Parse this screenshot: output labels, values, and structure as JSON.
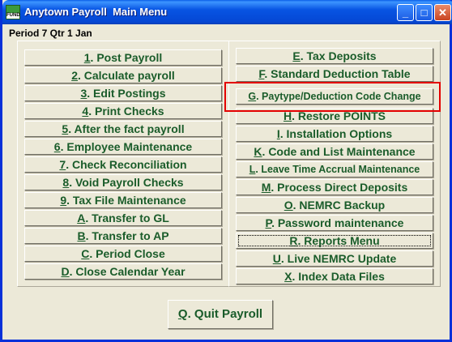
{
  "window": {
    "title": "Anytown Payroll  Main Menu",
    "icon_label": "FUND",
    "minimize": "_",
    "maximize": "□",
    "close": "✕"
  },
  "period": "Period 7 Qtr 1 Jan",
  "left_menu": [
    {
      "key": "1",
      "label": ". Post Payroll"
    },
    {
      "key": "2",
      "label": ". Calculate payroll"
    },
    {
      "key": "3",
      "label": ". Edit Postings"
    },
    {
      "key": "4",
      "label": ". Print Checks"
    },
    {
      "key": "5",
      "label": ". After the fact payroll"
    },
    {
      "key": "6",
      "label": ". Employee Maintenance"
    },
    {
      "key": "7",
      "label": ". Check Reconciliation"
    },
    {
      "key": "8",
      "label": ". Void Payroll Checks"
    },
    {
      "key": "9",
      "label": ". Tax File Maintenance"
    },
    {
      "key": "A",
      "label": ". Transfer to GL"
    },
    {
      "key": "B",
      "label": ". Transfer to AP"
    },
    {
      "key": "C",
      "label": ". Period Close"
    },
    {
      "key": "D",
      "label": ". Close Calendar Year"
    }
  ],
  "right_menu": [
    {
      "key": "E",
      "label": ". Tax Deposits"
    },
    {
      "key": "F",
      "label": ". Standard Deduction Table"
    },
    {
      "key": "G",
      "label": ". Paytype/Deduction Code Change"
    },
    {
      "key": "H",
      "label": ". Restore POINTS"
    },
    {
      "key": "I",
      "label": ". Installation Options"
    },
    {
      "key": "K",
      "label": ". Code and List Maintenance"
    },
    {
      "key": "L",
      "label": ". Leave Time Accrual Maintenance"
    },
    {
      "key": "M",
      "label": ". Process Direct Deposits"
    },
    {
      "key": "O",
      "label": ". NEMRC Backup"
    },
    {
      "key": "P",
      "label": ". Password maintenance"
    },
    {
      "key": "R",
      "label": ". Reports Menu"
    },
    {
      "key": "U",
      "label": ". Live NEMRC Update"
    },
    {
      "key": "X",
      "label": ". Index Data Files"
    }
  ],
  "quit": {
    "key": "Q",
    "label": ". Quit Payroll"
  },
  "colors": {
    "button_text": "#1a5c2a",
    "highlight": "#e30000",
    "title_bar": "#0854e3"
  }
}
